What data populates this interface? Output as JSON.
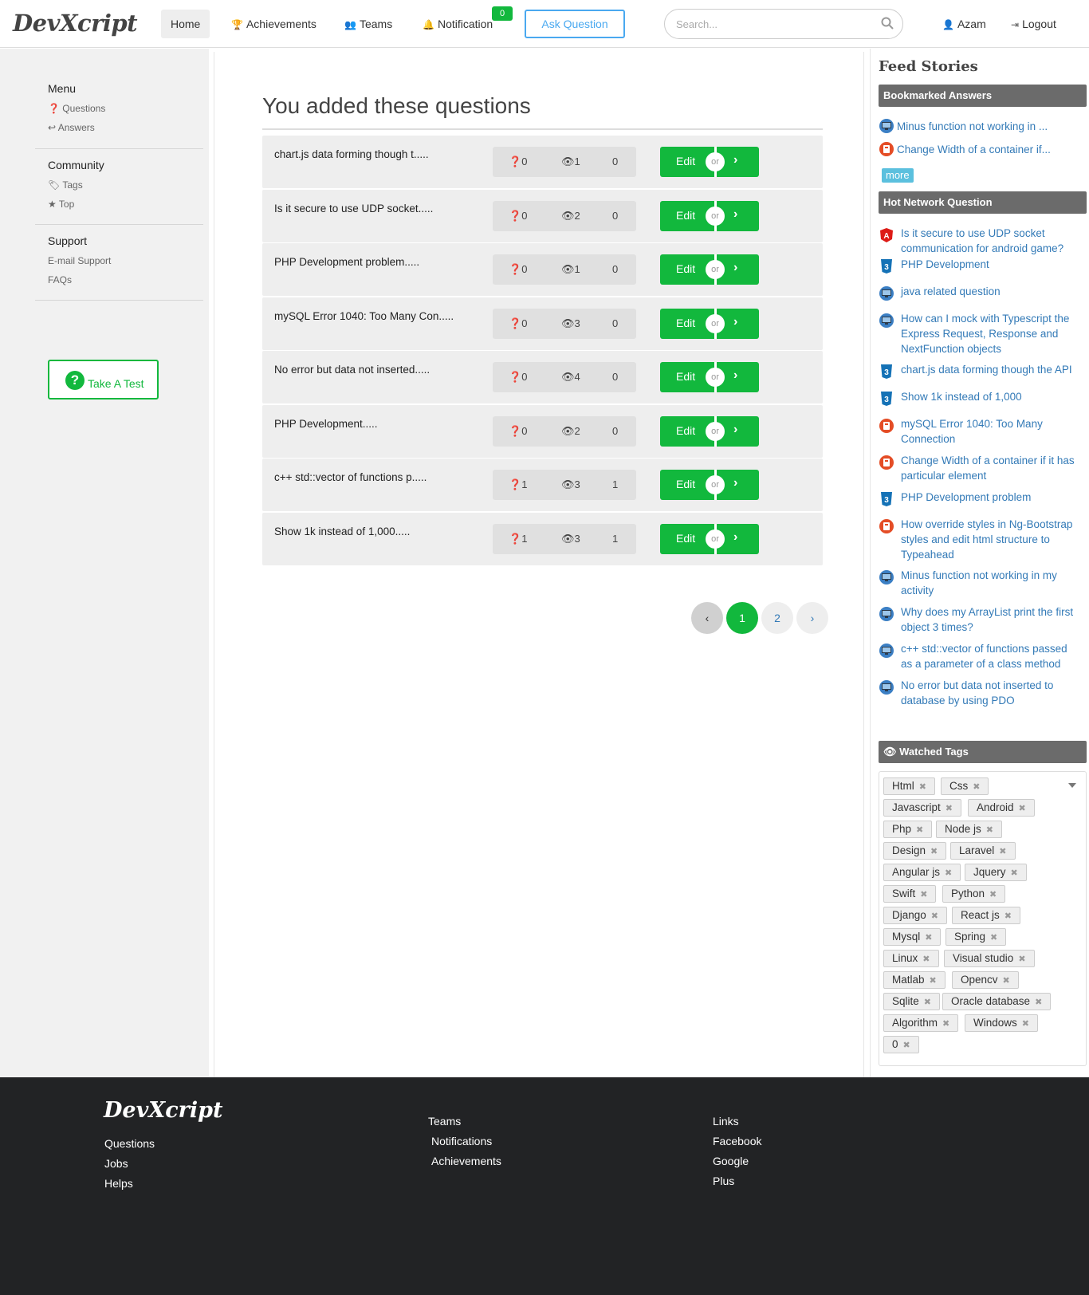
{
  "header": {
    "logo": "DevXcript",
    "nav": {
      "home": "Home",
      "achievements": "Achievements",
      "teams": "Teams",
      "notification": "Notification",
      "notification_count": "0"
    },
    "ask_button": "Ask Question",
    "search_placeholder": "Search...",
    "user": "Azam",
    "logout": "Logout"
  },
  "sidebar": {
    "menu_title": "Menu",
    "menu_items": [
      "Questions",
      "Answers"
    ],
    "community_title": "Community",
    "community_items": [
      "Tags",
      "Top"
    ],
    "support_title": "Support",
    "support_items": [
      "E-mail Support",
      "FAQs"
    ],
    "test_button": "Take A Test"
  },
  "main": {
    "title": "You added these questions",
    "questions": [
      {
        "title": "chart.js data forming though t.....",
        "answers": "0",
        "views": "1",
        "votes": "0"
      },
      {
        "title": "Is it secure to use UDP socket.....",
        "answers": "0",
        "views": "2",
        "votes": "0"
      },
      {
        "title": "PHP Development problem.....",
        "answers": "0",
        "views": "1",
        "votes": "0"
      },
      {
        "title": "mySQL Error 1040: Too Many Con.....",
        "answers": "0",
        "views": "3",
        "votes": "0"
      },
      {
        "title": "No error but data not inserted.....",
        "answers": "0",
        "views": "4",
        "votes": "0"
      },
      {
        "title": "PHP Development.....",
        "answers": "0",
        "views": "2",
        "votes": "0"
      },
      {
        "title": "c++ std::vector of functions p.....",
        "answers": "1",
        "views": "3",
        "votes": "1"
      },
      {
        "title": "Show 1k instead of 1,000.....",
        "answers": "1",
        "views": "3",
        "votes": "1"
      }
    ],
    "edit_label": "Edit",
    "or_label": "or",
    "pagination": {
      "prev": "‹",
      "pages": [
        "1",
        "2"
      ],
      "current": "1",
      "next": "›"
    }
  },
  "right": {
    "feed_title": "Feed Stories",
    "bookmarked_title": "Bookmarked Answers",
    "bookmarked": [
      {
        "text": "Minus function not working in ...",
        "icon": "monitor-icon"
      },
      {
        "text": "Change Width of a container if...",
        "icon": "html5-icon"
      }
    ],
    "more_label": "more",
    "hot_title": "Hot Network Question",
    "hot": [
      {
        "lines": [
          "Is it secure to use UDP socket",
          "communication for android game?"
        ],
        "icon": "angular-icon"
      },
      {
        "lines": [
          "PHP Development"
        ],
        "icon": "css3-icon"
      },
      {
        "lines": [
          "java related question"
        ],
        "icon": "monitor-icon"
      },
      {
        "lines": [
          "How can I mock with Typescript the",
          "Express Request, Response and",
          "NextFunction objects"
        ],
        "icon": "monitor-icon"
      },
      {
        "lines": [
          "chart.js data forming though the API"
        ],
        "icon": "css3-icon"
      },
      {
        "lines": [
          "Show 1k instead of 1,000"
        ],
        "icon": "css3-icon"
      },
      {
        "lines": [
          "mySQL Error 1040: Too Many",
          "Connection"
        ],
        "icon": "html5-icon"
      },
      {
        "lines": [
          "Change Width of a container if it has",
          "particular element"
        ],
        "icon": "html5-icon"
      },
      {
        "lines": [
          "PHP Development problem"
        ],
        "icon": "css3-icon"
      },
      {
        "lines": [
          "How override styles in Ng-Bootstrap",
          "styles and edit html structure to",
          "Typeahead"
        ],
        "icon": "html5-icon"
      },
      {
        "lines": [
          "Minus function not working in my",
          "activity"
        ],
        "icon": "monitor-icon"
      },
      {
        "lines": [
          "Why does my ArrayList print the first",
          "object 3 times?"
        ],
        "icon": "monitor-icon"
      },
      {
        "lines": [
          "c++ std::vector of functions passed",
          "as a parameter of a class method"
        ],
        "icon": "monitor-icon"
      },
      {
        "lines": [
          "No error but data not inserted to",
          "database by using PDO"
        ],
        "icon": "monitor-icon"
      }
    ],
    "watched_title": "Watched Tags",
    "tags": [
      "Html",
      "Css",
      "Javascript",
      "Android",
      "Php",
      "Node js",
      "Design",
      "Laravel",
      "Angular js",
      "Jquery",
      "Swift",
      "Python",
      "Django",
      "React js",
      "Mysql",
      "Spring",
      "Linux",
      "Visual studio",
      "Matlab",
      "Opencv",
      "Sqlite",
      "Oracle database",
      "Algorithm",
      "Windows",
      "0"
    ]
  },
  "footer": {
    "logo": "DevXcript",
    "col1": [
      "Questions",
      "Jobs",
      "Helps"
    ],
    "col2": [
      "Teams",
      "Notifications",
      "Achievements"
    ],
    "col3": [
      "Links",
      "Facebook",
      "Google",
      "Plus"
    ]
  },
  "colors": {
    "accent_green": "#12b83d",
    "link_blue": "#337ab7",
    "panel_gray": "#6b6b6b",
    "footer_bg": "#222325"
  }
}
